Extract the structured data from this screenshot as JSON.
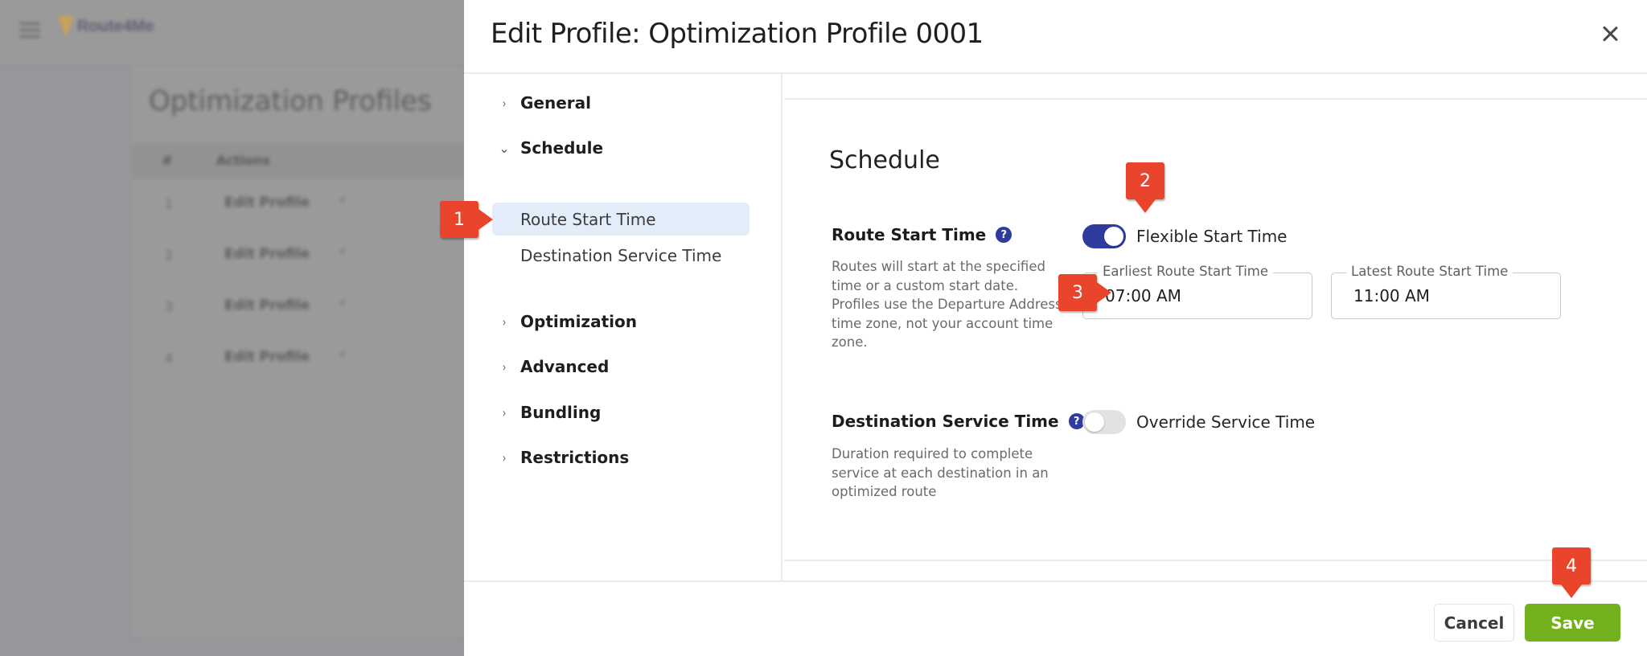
{
  "background": {
    "logo_text": "Route4Me",
    "page_title": "Optimization Profiles",
    "table": {
      "columns": [
        "#",
        "Actions"
      ],
      "rows": [
        {
          "num": "1",
          "action": "Edit Profile"
        },
        {
          "num": "2",
          "action": "Edit Profile"
        },
        {
          "num": "3",
          "action": "Edit Profile"
        },
        {
          "num": "4",
          "action": "Edit Profile"
        }
      ],
      "caret": "▾"
    }
  },
  "modal": {
    "title": "Edit Profile: Optimization Profile 0001",
    "close_icon": "close-icon",
    "nav": {
      "groups": [
        {
          "label": "General",
          "expanded": false,
          "chevron": "›"
        },
        {
          "label": "Schedule",
          "expanded": true,
          "chevron": "⌄"
        },
        {
          "label": "Optimization",
          "expanded": false,
          "chevron": "›"
        },
        {
          "label": "Advanced",
          "expanded": false,
          "chevron": "›"
        },
        {
          "label": "Bundling",
          "expanded": false,
          "chevron": "›"
        },
        {
          "label": "Restrictions",
          "expanded": false,
          "chevron": "›"
        }
      ],
      "schedule_items": [
        {
          "label": "Route Start Time",
          "active": true
        },
        {
          "label": "Destination Service Time",
          "active": false
        }
      ]
    },
    "content": {
      "section_title": "Schedule",
      "route_start_time": {
        "label": "Route Start Time",
        "help": "?",
        "description": "Routes will start at the specified time or a custom start date. Profiles use the Departure Address time zone, not your account time zone.",
        "toggle_label": "Flexible Start Time",
        "toggle_on": true,
        "earliest": {
          "label": "Earliest Route Start Time",
          "value": "07:00 AM"
        },
        "latest": {
          "label": "Latest Route Start Time",
          "value": "11:00 AM"
        }
      },
      "destination_service_time": {
        "label": "Destination Service Time",
        "help": "?",
        "description": "Duration required to complete service at each destination in an optimized route",
        "toggle_label": "Override Service Time",
        "toggle_on": false
      }
    },
    "footer": {
      "cancel_label": "Cancel",
      "save_label": "Save"
    }
  },
  "annotations": [
    "1",
    "2",
    "3",
    "4"
  ],
  "colors": {
    "accent": "#2f3b9e",
    "save": "#72b01d",
    "nav_active_bg": "#e3ecf9",
    "marker": "#e8452c"
  }
}
